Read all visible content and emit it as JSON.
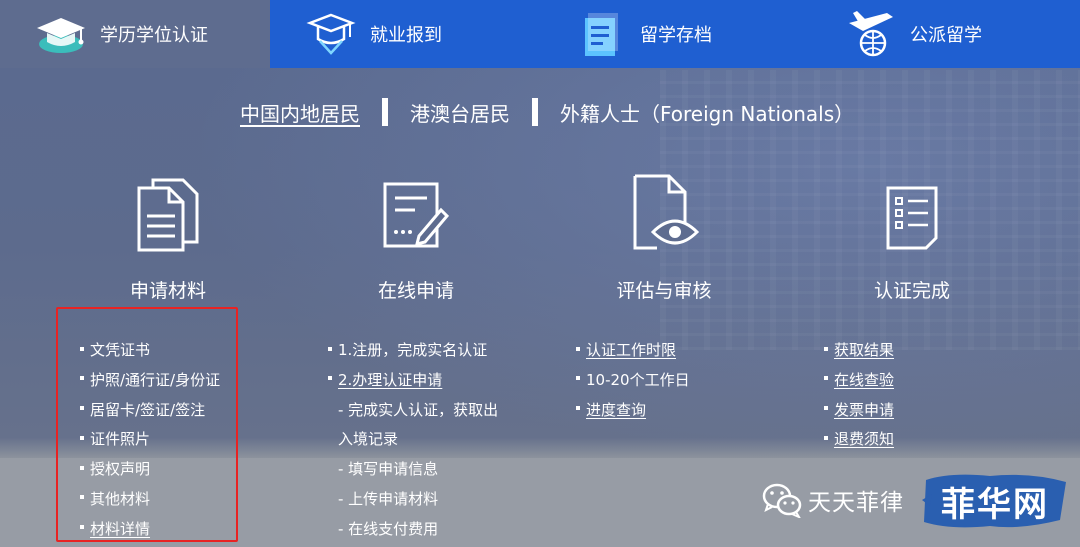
{
  "nav": {
    "tabs": [
      {
        "label": "学历学位认证",
        "icon": "graduation-cap-icon"
      },
      {
        "label": "就业报到",
        "icon": "cap-badge-icon"
      },
      {
        "label": "留学存档",
        "icon": "document-archive-icon"
      },
      {
        "label": "公派留学",
        "icon": "plane-globe-icon"
      }
    ]
  },
  "regions": [
    "中国内地居民",
    "港澳台居民",
    "外籍人士（Foreign Nationals）"
  ],
  "steps": [
    {
      "title": "申请材料",
      "icon": "documents-icon"
    },
    {
      "title": "在线申请",
      "icon": "form-pen-icon"
    },
    {
      "title": "评估与审核",
      "icon": "document-eye-icon"
    },
    {
      "title": "认证完成",
      "icon": "checklist-icon"
    }
  ],
  "lists": {
    "materials": [
      "文凭证书",
      "护照/通行证/身份证",
      "居留卡/签证/签注",
      "证件照片",
      "授权声明",
      "其他材料",
      "材料详情"
    ],
    "online": [
      "1.注册，完成实名认证",
      "2.办理认证申请",
      "- 完成实人认证，获取出",
      "入境记录",
      "- 填写申请信息",
      "- 上传申请材料",
      "- 在线支付费用"
    ],
    "review": [
      "认证工作时限",
      "10-20个工作日",
      "进度查询"
    ],
    "complete": [
      "获取结果",
      "在线查验",
      "发票申请",
      "退费须知"
    ]
  },
  "watermark": {
    "text": "天天菲律",
    "logo_text": "菲华网",
    "icon": "wechat-icon"
  },
  "colors": {
    "nav_blue": "#1f5fd1",
    "highlight_red": "#e82323",
    "logo_blue": "#2a5fb0"
  }
}
